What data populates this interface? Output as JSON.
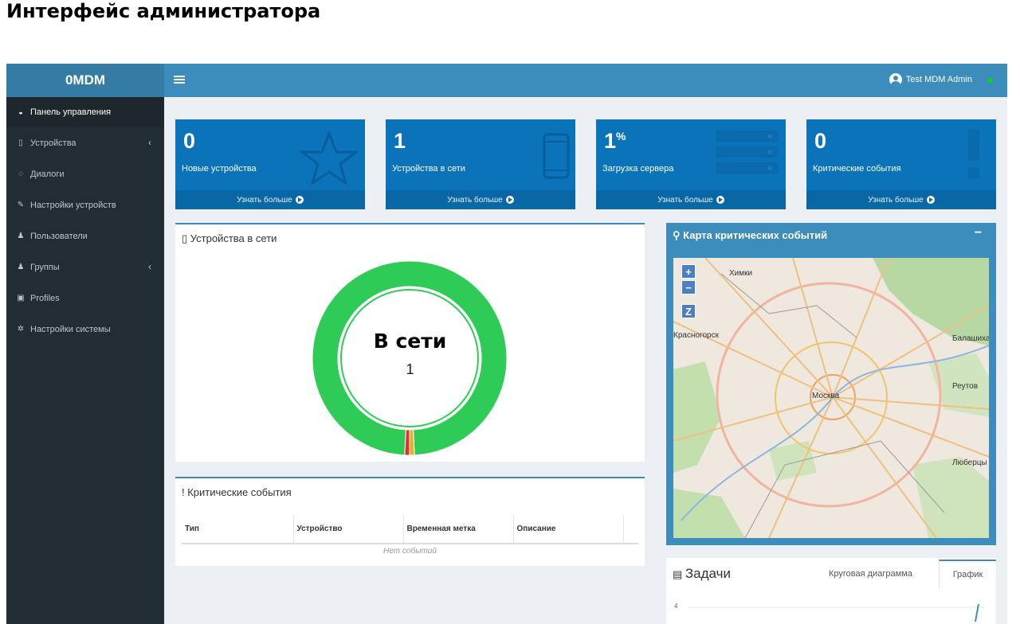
{
  "document_title": "Интерфейс администратора",
  "app": {
    "logo": "0MDM",
    "user_name": "Test MDM Admin"
  },
  "sidebar": {
    "items": [
      {
        "label": "Панель управления",
        "icon": "dashboard-icon",
        "active": true,
        "has_submenu": false
      },
      {
        "label": "Устройства",
        "icon": "mobile-icon",
        "active": false,
        "has_submenu": true
      },
      {
        "label": "Диалоги",
        "icon": "comments-icon",
        "active": false,
        "has_submenu": false
      },
      {
        "label": "Настройки устройств",
        "icon": "edit-icon",
        "active": false,
        "has_submenu": false
      },
      {
        "label": "Пользователи",
        "icon": "user-icon",
        "active": false,
        "has_submenu": false
      },
      {
        "label": "Группы",
        "icon": "users-icon",
        "active": false,
        "has_submenu": true
      },
      {
        "label": "Profiles",
        "icon": "image-icon",
        "active": false,
        "has_submenu": false
      },
      {
        "label": "Настройки системы",
        "icon": "gear-icon",
        "active": false,
        "has_submenu": false
      }
    ],
    "chevron": "‹"
  },
  "info_boxes": [
    {
      "value": "0",
      "suffix": "",
      "label": "Новые устройства",
      "footer": "Узнать больше",
      "icon": "star-icon"
    },
    {
      "value": "1",
      "suffix": "",
      "label": "Устройства в сети",
      "footer": "Узнать больше",
      "icon": "phone-icon"
    },
    {
      "value": "1",
      "suffix": "%",
      "label": "Загрузка сервера",
      "footer": "Узнать больше",
      "icon": "server-icon"
    },
    {
      "value": "0",
      "suffix": "",
      "label": "Критические события",
      "footer": "Узнать больше",
      "icon": "exclamation-icon"
    }
  ],
  "devices_panel": {
    "title": "▯ Устройства в сети",
    "center_label": "В сети",
    "center_count": "1"
  },
  "chart_data": {
    "type": "pie",
    "categories": [
      "В сети",
      "",
      ""
    ],
    "values": [
      98.4,
      0.8,
      0.8
    ],
    "colors": [
      "#2ecc57",
      "#e8b020",
      "#e03030"
    ]
  },
  "events_panel": {
    "title": "! Критические события",
    "columns": [
      "Тип",
      "Устройство",
      "Временная метка",
      "Описание",
      ""
    ],
    "empty_text": "Нет событий"
  },
  "map_panel": {
    "title": "⚲ Карта критических событий",
    "collapse": "−",
    "zoom_in": "+",
    "zoom_out": "−",
    "zoom_select": "Z",
    "labels": [
      "Химки",
      "Москва",
      "Люберцы",
      "Красногорск",
      "Реутов",
      "Балашиха"
    ]
  },
  "tasks_panel": {
    "title": "Задачи",
    "tab_pie": "Круговая диаграмма",
    "tab_chart": "График",
    "y_tick": "4"
  },
  "colors": {
    "header": "#3c8dbc",
    "logo_bg": "#357ca5",
    "sidebar": "#222d32",
    "info_box": "#0b73b9",
    "online": "#2ecc57"
  }
}
